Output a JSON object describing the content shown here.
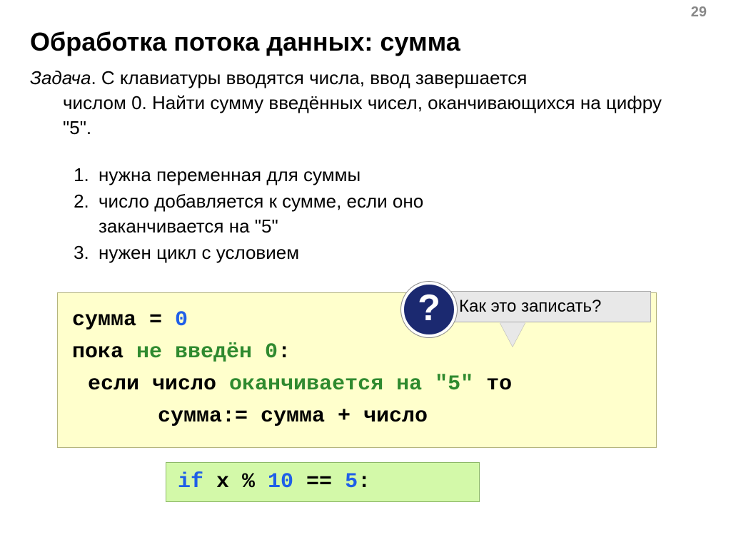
{
  "page_number": "29",
  "title": "Обработка потока данных: сумма",
  "task": {
    "label": "Задача",
    "line1": ". С клавиатуры вводятся числа, ввод завершается",
    "line2": "числом 0. Найти сумму введённых чисел, оканчивающихся на цифру \"5\"."
  },
  "steps": {
    "item1": "нужна переменная для суммы",
    "item2a": "число добавляется к сумме, если оно",
    "item2b": "заканчивается на \"5\"",
    "item3": "нужен цикл с условием"
  },
  "pseudocode": {
    "l1a": "сумма = ",
    "l1b": "0",
    "l2a": "пока ",
    "l2b": "не введён 0",
    "l2c": ":",
    "l3a": "если число ",
    "l3b": "оканчивается на \"5\"",
    "l3c": " то",
    "l4": "сумма:= сумма + число"
  },
  "callout": {
    "mark": "?",
    "text": "Как это записать?"
  },
  "code2": {
    "a": "if",
    "b": " x % ",
    "c": "10",
    "d": " == ",
    "e": "5",
    "f": ":"
  }
}
